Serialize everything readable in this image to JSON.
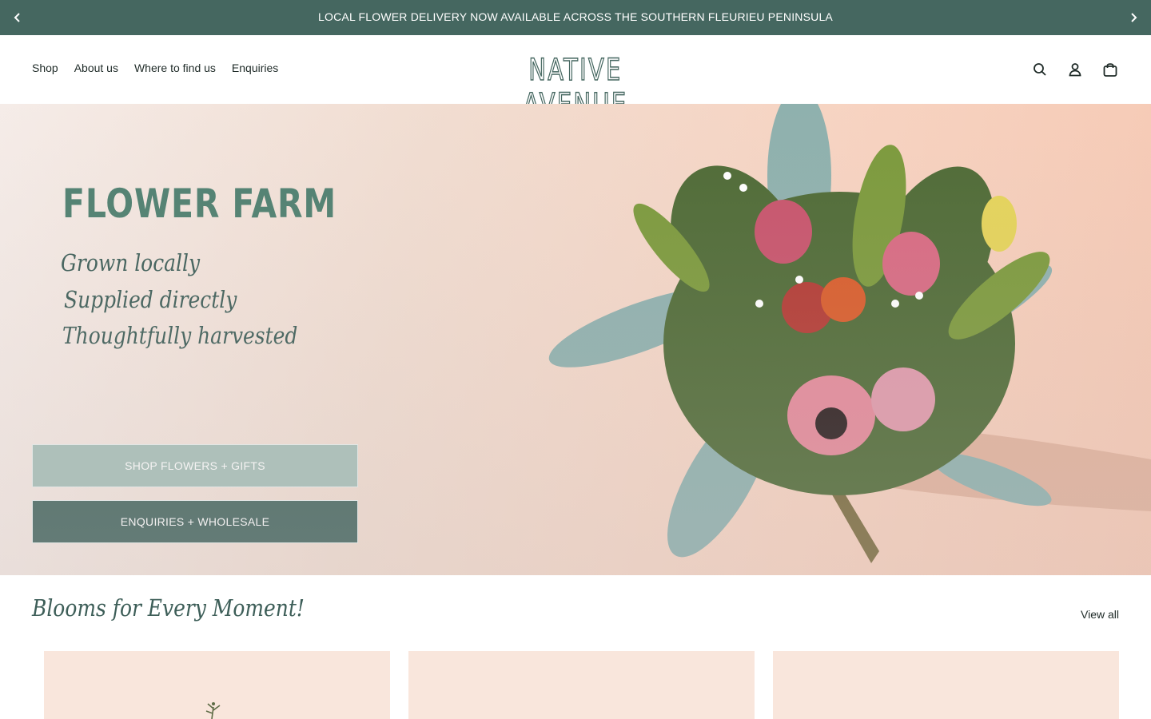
{
  "announcement": {
    "text": "LOCAL FLOWER DELIVERY NOW AVAILABLE ACROSS THE SOUTHERN FLEURIEU PENINSULA",
    "prev_icon": "chevron-left-icon",
    "next_icon": "chevron-right-icon"
  },
  "header": {
    "nav": [
      "Shop",
      "About us",
      "Where to find us",
      "Enquiries"
    ],
    "logo": "NATIVE AVENUE",
    "icons": [
      "search-icon",
      "account-icon",
      "cart-icon"
    ]
  },
  "hero": {
    "title": "FLOWER FARM",
    "taglines": [
      "Grown locally",
      "Supplied directly",
      "Thoughtfully harvested"
    ],
    "buttons": {
      "shop": "SHOP FLOWERS + GIFTS",
      "enquiries": "ENQUIRIES + WHOLESALE"
    }
  },
  "section": {
    "title": "Blooms for Every Moment!",
    "view_all": "View all"
  },
  "colors": {
    "accent": "#456760",
    "light_accent": "#a8c1b9",
    "hero_title": "#4f8070",
    "card_bg": "#f9e6dc"
  }
}
